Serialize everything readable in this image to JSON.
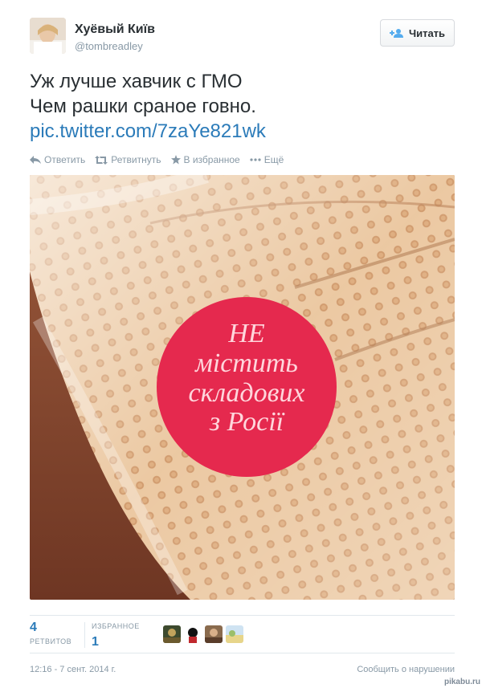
{
  "user": {
    "display_name": "Хуёвый Київ",
    "username": "@tombreadley",
    "follow_label": "Читать"
  },
  "tweet": {
    "lines": [
      "Уж лучше хавчик с ГМО",
      "Чем рашки сраное говно."
    ],
    "link": "pic.twitter.com/7zaYe821wk"
  },
  "actions": {
    "reply": "Ответить",
    "retweet": "Ретвитнуть",
    "favorite": "В избранное",
    "more": "Ещё"
  },
  "photo": {
    "sticker_lines": [
      "НЕ",
      "містить",
      "складових",
      "з Росії"
    ]
  },
  "stats": {
    "retweets_count": "4",
    "retweets_label": "РЕТВИТОВ",
    "favorites_label": "ИЗБРАННОЕ",
    "favorites_count": "1"
  },
  "footer": {
    "timestamp": "12:16 - 7 сент. 2014 г.",
    "report": "Сообщить о нарушении"
  },
  "watermark": "pikabu.ru",
  "colors": {
    "link": "#2b7bb9",
    "muted": "#8899a6",
    "sticker": "#e5294e"
  }
}
